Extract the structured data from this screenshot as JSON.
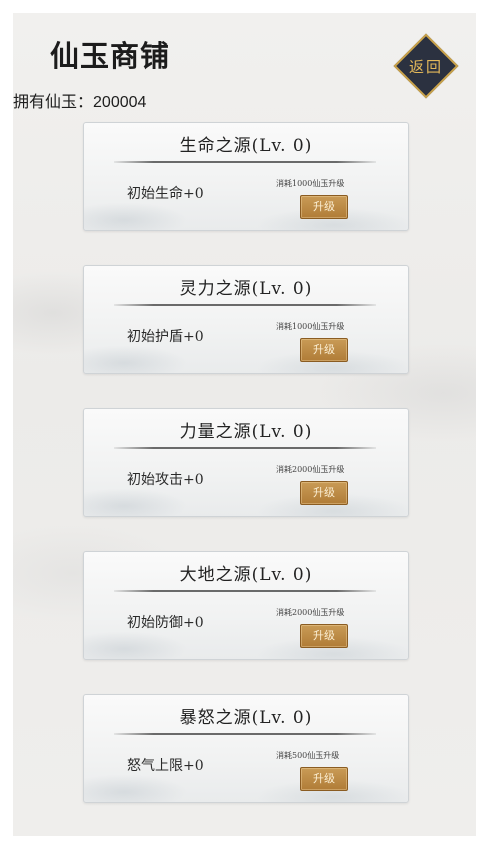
{
  "header": {
    "title": "仙玉商铺",
    "balance_label": "拥有仙玉：",
    "balance_value": "200004",
    "back_label": "返回"
  },
  "upgrades": [
    {
      "title": "生命之源(Lv. 0)",
      "stat": "初始生命+0",
      "cost": "消耗1000仙玉升级",
      "button": "升级"
    },
    {
      "title": "灵力之源(Lv. 0)",
      "stat": "初始护盾+0",
      "cost": "消耗1000仙玉升级",
      "button": "升级"
    },
    {
      "title": "力量之源(Lv. 0)",
      "stat": "初始攻击+0",
      "cost": "消耗2000仙玉升级",
      "button": "升级"
    },
    {
      "title": "大地之源(Lv. 0)",
      "stat": "初始防御+0",
      "cost": "消耗2000仙玉升级",
      "button": "升级"
    },
    {
      "title": "暴怒之源(Lv. 0)",
      "stat": "怒气上限+0",
      "cost": "消耗500仙玉升级",
      "button": "升级"
    }
  ],
  "colors": {
    "accent_gold": "#c9a24a",
    "button_bronze": "#b07c37",
    "back_bg": "#2b3140"
  }
}
